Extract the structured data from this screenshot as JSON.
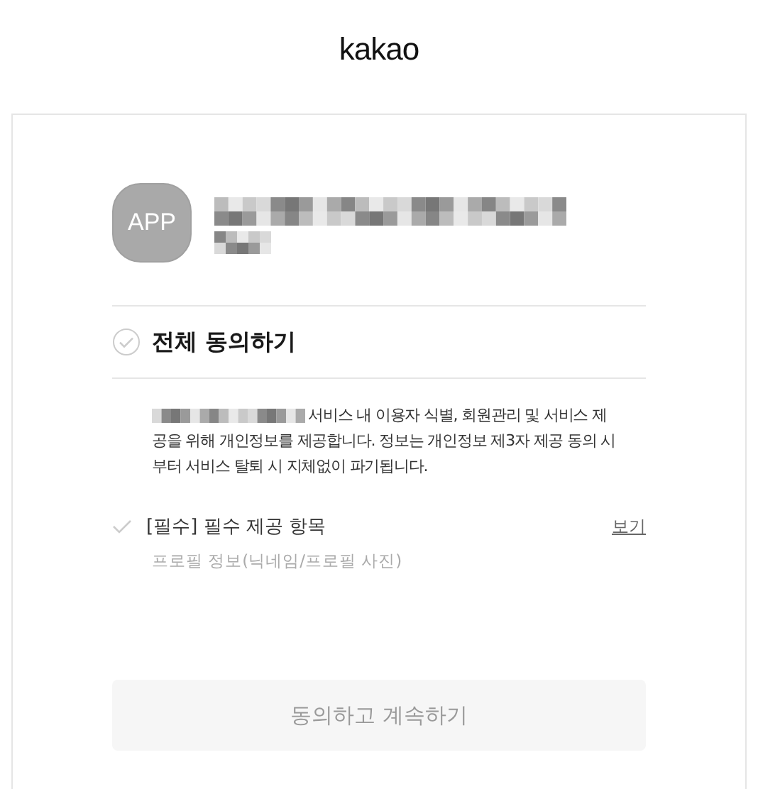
{
  "header": {
    "logo": "kakao"
  },
  "app": {
    "icon_label": "APP"
  },
  "agree_all": {
    "label": "전체 동의하기",
    "checked": false
  },
  "description_lines": [
    "서비스 내 이용자 식별, 회원관리 및 서비스 제",
    "공을 위해 개인정보를 제공합니다. 정보는 개인정보 제3자 제공 동의 시",
    "부터 서비스 탈퇴 시 지체없이 파기됩니다."
  ],
  "items": [
    {
      "label": "[필수] 필수 제공 항목",
      "checked": false,
      "link": "보기",
      "detail": "프로필 정보(닉네임/프로필 사진)"
    }
  ],
  "submit": {
    "label": "동의하고 계속하기",
    "disabled": true
  }
}
